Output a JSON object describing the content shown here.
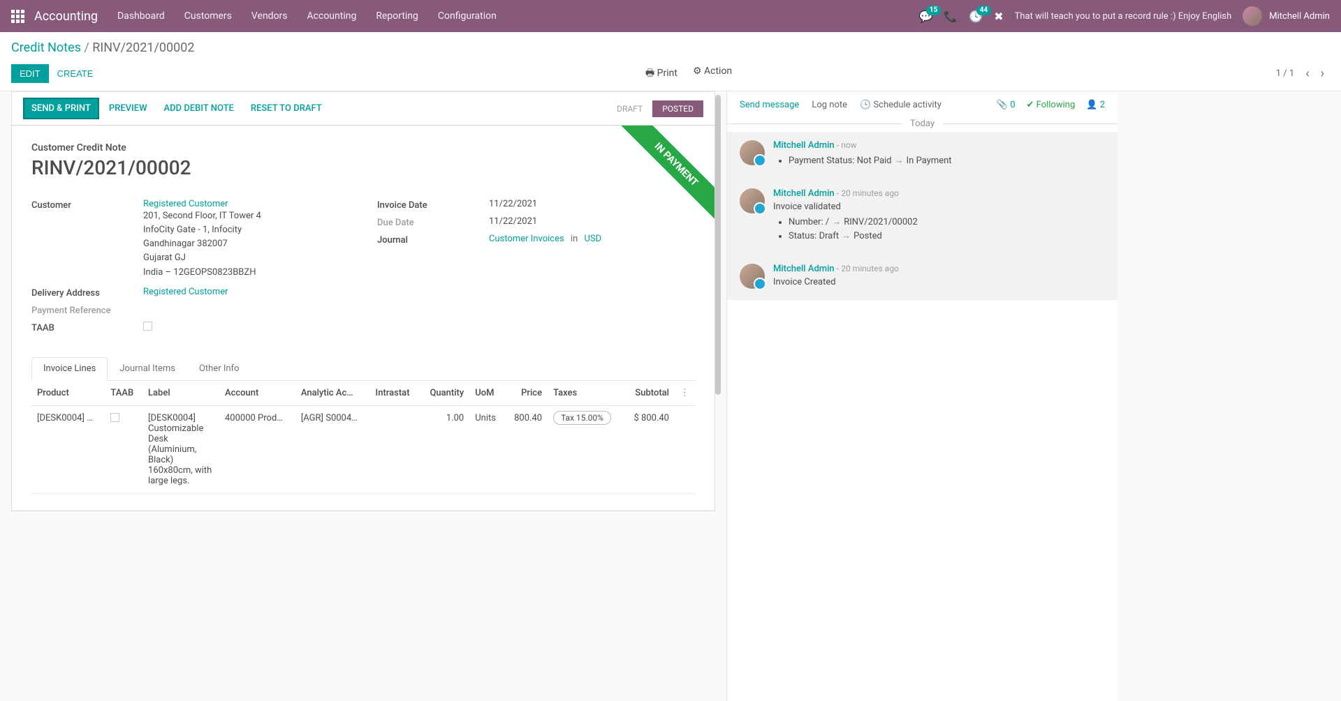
{
  "header": {
    "brand": "Accounting",
    "nav": [
      "Dashboard",
      "Customers",
      "Vendors",
      "Accounting",
      "Reporting",
      "Configuration"
    ],
    "chat_badge": "15",
    "activity_badge": "44",
    "tagline": "That will teach you to put a record rule :) Enjoy English",
    "user": "Mitchell Admin"
  },
  "breadcrumb": {
    "parent": "Credit Notes",
    "current": "RINV/2021/00002"
  },
  "control": {
    "edit": "EDIT",
    "create": "CREATE",
    "print": "Print",
    "action": "Action",
    "pager": "1 / 1"
  },
  "statusbar": {
    "buttons": [
      "SEND & PRINT",
      "PREVIEW",
      "ADD DEBIT NOTE",
      "RESET TO DRAFT"
    ],
    "draft": "DRAFT",
    "posted": "POSTED"
  },
  "form": {
    "ribbon": "IN PAYMENT",
    "title_label": "Customer Credit Note",
    "title": "RINV/2021/00002",
    "labels": {
      "customer": "Customer",
      "delivery": "Delivery Address",
      "payment_ref": "Payment Reference",
      "taab": "TAAB",
      "invoice_date": "Invoice Date",
      "due_date": "Due Date",
      "journal": "Journal"
    },
    "customer_name": "Registered Customer",
    "address_lines": [
      "201, Second Floor, IT Tower 4",
      "InfoCity Gate - 1, Infocity",
      "Gandhinagar 382007",
      "Gujarat GJ",
      "India – 12GEOPS0823BBZH"
    ],
    "delivery": "Registered Customer",
    "invoice_date": "11/22/2021",
    "due_date": "11/22/2021",
    "journal_value": "Customer Invoices",
    "journal_in": "in",
    "journal_currency": "USD"
  },
  "tabs": [
    "Invoice Lines",
    "Journal Items",
    "Other Info"
  ],
  "table": {
    "headers": [
      "Product",
      "TAAB",
      "Label",
      "Account",
      "Analytic Ac…",
      "Intrastat",
      "Quantity",
      "UoM",
      "Price",
      "Taxes",
      "Subtotal"
    ],
    "row": {
      "product": "[DESK0004] …",
      "label": "[DESK0004] Customizable Desk (Aluminium, Black) 160x80cm, with large legs.",
      "account": "400000 Prod…",
      "analytic": "[AGR] S0004…",
      "qty": "1.00",
      "uom": "Units",
      "price": "800.40",
      "tax": "Tax 15.00%",
      "subtotal": "$ 800.40"
    }
  },
  "chatter": {
    "send": "Send message",
    "log": "Log note",
    "schedule": "Schedule activity",
    "attachments": "0",
    "following": "Following",
    "followers": "2",
    "today": "Today",
    "messages": [
      {
        "user": "Mitchell Admin",
        "time": "now",
        "lines": [
          {
            "label": "Payment Status:",
            "from": "Not Paid",
            "to": "In Payment"
          }
        ]
      },
      {
        "user": "Mitchell Admin",
        "time": "20 minutes ago",
        "text": "Invoice validated",
        "lines": [
          {
            "label": "Number:",
            "from": "/",
            "to": "RINV/2021/00002"
          },
          {
            "label": "Status:",
            "from": "Draft",
            "to": "Posted"
          }
        ]
      },
      {
        "user": "Mitchell Admin",
        "time": "20 minutes ago",
        "text": "Invoice Created"
      }
    ]
  }
}
